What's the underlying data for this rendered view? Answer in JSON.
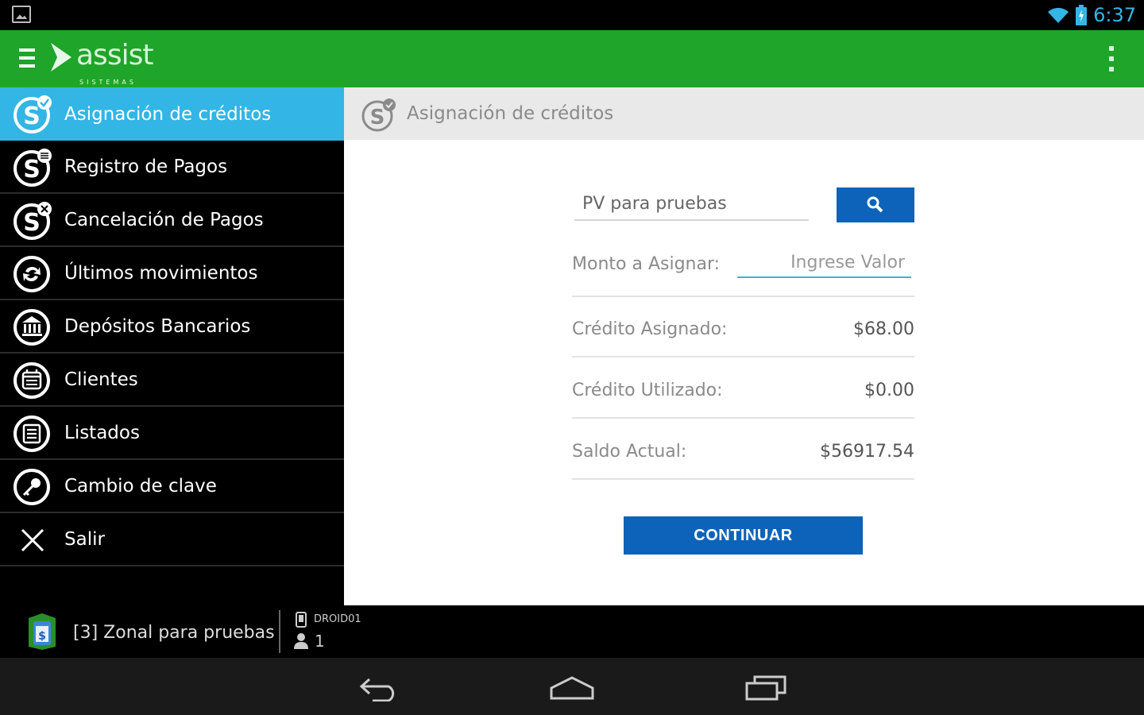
{
  "status_bar": {
    "time": "6:37",
    "icons": [
      "image-notification-icon",
      "wifi-icon",
      "battery-icon"
    ]
  },
  "action_bar": {
    "logo_text": "assist",
    "logo_subtext": "SISTEMAS",
    "color": "#1fa52a"
  },
  "drawer": {
    "items": [
      {
        "label": "Asignación de créditos",
        "icon": "credit-assign-icon",
        "active": true
      },
      {
        "label": "Registro de Pagos",
        "icon": "payment-register-icon"
      },
      {
        "label": "Cancelación de Pagos",
        "icon": "payment-cancel-icon"
      },
      {
        "label": "Últimos movimientos",
        "icon": "movements-icon"
      },
      {
        "label": "Depósitos Bancarios",
        "icon": "bank-icon"
      },
      {
        "label": "Clientes",
        "icon": "clients-icon"
      },
      {
        "label": "Listados",
        "icon": "list-icon"
      },
      {
        "label": "Cambio de clave",
        "icon": "key-icon"
      },
      {
        "label": "Salir",
        "icon": "close-icon"
      }
    ],
    "active_color": "#33b5e5"
  },
  "content": {
    "header_title": "Asignación de créditos",
    "pv_value": "PV para pruebas",
    "monto_label": "Monto a Asignar:",
    "monto_placeholder": "Ingrese Valor",
    "rows": [
      {
        "label": "Crédito Asignado:",
        "value": "$68.00"
      },
      {
        "label": "Crédito Utilizado:",
        "value": "$0.00"
      },
      {
        "label": "Saldo Actual:",
        "value": "$56917.54"
      }
    ],
    "continue_label": "CONTINUAR",
    "button_color": "#0d63b9"
  },
  "info_bar": {
    "zone_label": "[3] Zonal para pruebas",
    "device_id": "DROID01",
    "user_count": "1"
  },
  "nav_bar": {
    "buttons": [
      "back-icon",
      "home-icon",
      "recents-icon"
    ]
  }
}
